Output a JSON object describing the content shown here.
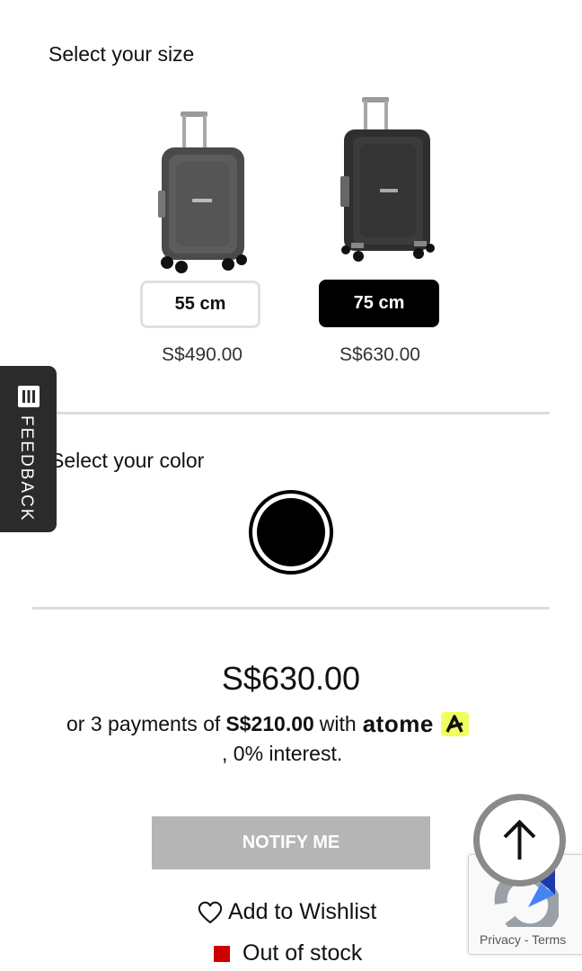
{
  "size_section": {
    "title": "Select your size",
    "options": [
      {
        "label": "55 cm",
        "price": "S$490.00",
        "selected": false
      },
      {
        "label": "75 cm",
        "price": "S$630.00",
        "selected": true
      }
    ]
  },
  "color_section": {
    "title": "Select your color",
    "swatch_color": "#000000"
  },
  "feedback": {
    "label": "FEEDBACK"
  },
  "pricing": {
    "price": "S$630.00",
    "installment_prefix": "or 3 payments of",
    "installment_amount": "S$210.00",
    "installment_with": "with",
    "provider": "atome",
    "interest": ", 0% interest."
  },
  "actions": {
    "notify": "NOTIFY ME",
    "wishlist": "Add to Wishlist"
  },
  "stock": {
    "label": "Out of stock",
    "color": "#cc0000"
  },
  "recaptcha": {
    "privacy": "Privacy",
    "separator": " - ",
    "terms": "Terms"
  },
  "colors": {
    "accent": "#000000",
    "notify_button": "#b5b5b5",
    "atome_badge": "#f0ff5f"
  }
}
